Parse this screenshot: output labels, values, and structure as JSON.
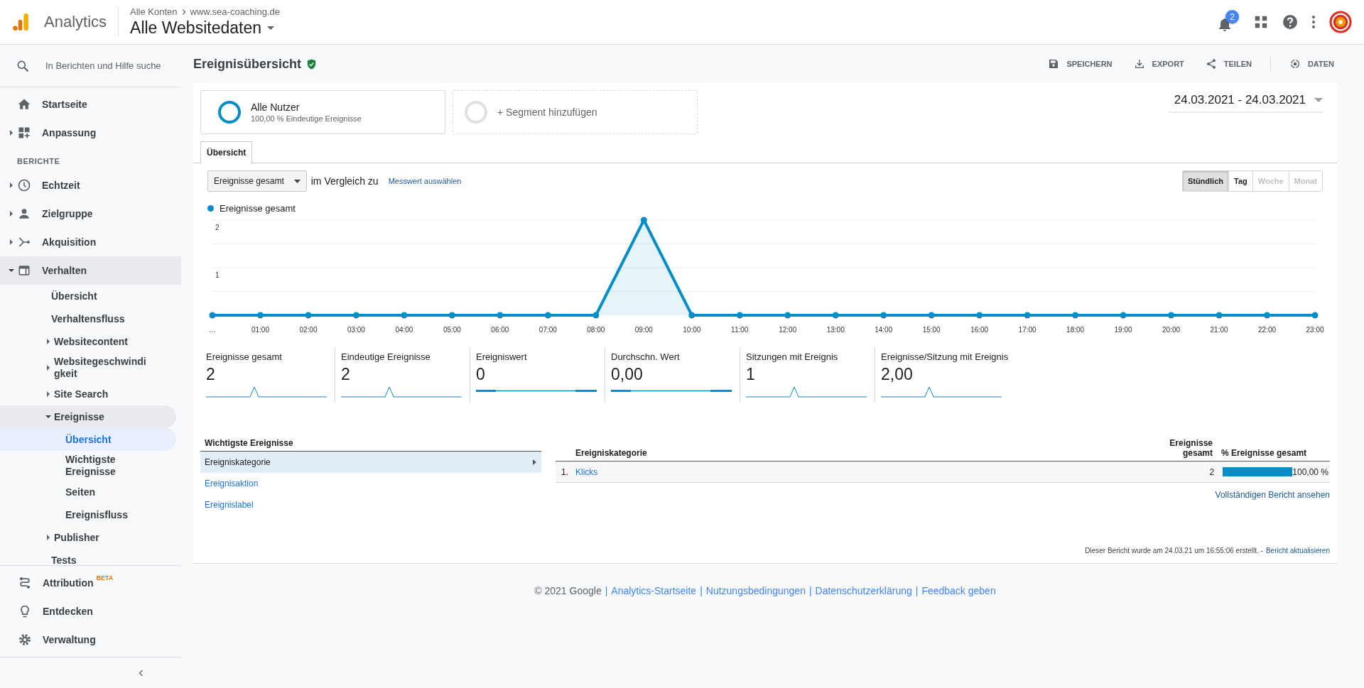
{
  "header": {
    "product": "Analytics",
    "breadcrumb": [
      "Alle Konten",
      "www.sea-coaching.de"
    ],
    "view": "Alle Websitedaten",
    "notification_count": "2"
  },
  "sidebar": {
    "search_placeholder": "In Berichten und Hilfe suche",
    "items": [
      {
        "kind": "item",
        "label": "Startseite",
        "selected": false
      },
      {
        "kind": "item",
        "label": "Anpassung",
        "expanded": false,
        "selected": false
      },
      {
        "kind": "heading",
        "label": "BERICHTE"
      },
      {
        "kind": "item",
        "label": "Echtzeit",
        "expanded": false,
        "selected": false
      },
      {
        "kind": "item",
        "label": "Zielgruppe",
        "expanded": false,
        "selected": false
      },
      {
        "kind": "item",
        "label": "Akquisition",
        "expanded": false,
        "selected": false
      },
      {
        "kind": "item",
        "label": "Verhalten",
        "expanded": true,
        "selected": false,
        "children": [
          {
            "label": "Übersicht",
            "selected": false
          },
          {
            "label": "Verhaltensfluss",
            "selected": false
          },
          {
            "label": "Websitecontent",
            "expanded": false,
            "selected": false
          },
          {
            "label": "Websitegeschwindigkeit",
            "expanded": false,
            "selected": false
          },
          {
            "label": "Site Search",
            "expanded": false,
            "selected": false
          },
          {
            "label": "Ereignisse",
            "expanded": true,
            "selected": false,
            "children": [
              {
                "label": "Übersicht",
                "selected": true
              },
              {
                "label": "Wichtigste Ereignisse",
                "selected": false
              },
              {
                "label": "Seiten",
                "selected": false
              },
              {
                "label": "Ereignisfluss",
                "selected": false
              }
            ]
          },
          {
            "label": "Publisher",
            "expanded": false,
            "selected": false
          },
          {
            "label": "Tests",
            "selected": false
          }
        ]
      }
    ],
    "bottom_items": [
      {
        "label": "Attribution",
        "badge": "BETA"
      },
      {
        "label": "Entdecken"
      },
      {
        "label": "Verwaltung"
      }
    ]
  },
  "page": {
    "title": "Ereignisübersicht",
    "actions": [
      "SPEICHERN",
      "EXPORT",
      "TEILEN",
      "DATEN"
    ],
    "segments": [
      {
        "kind": "active",
        "name": "Alle Nutzer",
        "detail": "100,00 % Eindeutige Ereignisse"
      },
      {
        "kind": "add",
        "name": "+ Segment hinzufügen"
      }
    ],
    "date_range": "24.03.2021 - 24.03.2021",
    "tabs": [
      {
        "label": "Übersicht",
        "selected": true
      }
    ],
    "metric_select": "Ereignisse gesamt",
    "compare_label": "im Vergleich zu",
    "compare_link": "Messwert auswählen",
    "granularity": [
      {
        "label": "Stündlich",
        "selected": true,
        "disabled": false
      },
      {
        "label": "Tag",
        "selected": false,
        "disabled": false
      },
      {
        "label": "Woche",
        "selected": false,
        "disabled": true
      },
      {
        "label": "Monat",
        "selected": false,
        "disabled": true
      }
    ],
    "chart_data": {
      "type": "area",
      "categories": [
        "…",
        "01:00",
        "02:00",
        "03:00",
        "04:00",
        "05:00",
        "06:00",
        "07:00",
        "08:00",
        "09:00",
        "10:00",
        "11:00",
        "12:00",
        "13:00",
        "14:00",
        "15:00",
        "16:00",
        "17:00",
        "18:00",
        "19:00",
        "20:00",
        "21:00",
        "22:00",
        "23:00"
      ],
      "series": [
        {
          "name": "Ereignisse gesamt",
          "color": "#058dc7",
          "values": [
            0,
            0,
            0,
            0,
            0,
            0,
            0,
            0,
            0,
            2,
            0,
            0,
            0,
            0,
            0,
            0,
            0,
            0,
            0,
            0,
            0,
            0,
            0,
            0
          ]
        }
      ],
      "ylim": [
        0,
        2
      ],
      "yticks": [
        1,
        2
      ]
    },
    "scorecards": [
      {
        "label": "Ereignisse gesamt",
        "value": "2",
        "kind": "spike"
      },
      {
        "label": "Eindeutige Ereignisse",
        "value": "2",
        "kind": "spike"
      },
      {
        "label": "Ereigniswert",
        "value": "0",
        "kind": "flat"
      },
      {
        "label": "Durchschn. Wert",
        "value": "0,00",
        "kind": "flat"
      },
      {
        "label": "Sitzungen mit Ereignis",
        "value": "1",
        "kind": "spike"
      },
      {
        "label": "Ereignisse/Sitzung mit Ereignis",
        "value": "2,00",
        "kind": "spike"
      }
    ],
    "top_events": {
      "title": "Wichtigste Ereignisse",
      "items": [
        {
          "label": "Ereigniskategorie",
          "selected": true
        },
        {
          "label": "Ereignisaktion",
          "selected": false
        },
        {
          "label": "Ereignislabel",
          "selected": false
        }
      ]
    },
    "table": {
      "columns": [
        "Ereigniskategorie",
        "Ereignisse gesamt",
        "% Ereignisse gesamt"
      ],
      "rows": [
        {
          "rank": "1.",
          "name": "Klicks",
          "value": "2",
          "level": 1.0,
          "percent": "100,00 %"
        }
      ],
      "full_report_link": "Vollständigen Bericht ansehen"
    },
    "report_note": "Dieser Bericht wurde am 24.03.21 um 16:55:06 erstellt. -",
    "report_refresh": "Bericht aktualisieren"
  },
  "footer": [
    {
      "kind": "text",
      "text": "© 2021 Google"
    },
    {
      "kind": "sep",
      "text": "|"
    },
    {
      "kind": "link",
      "text": "Analytics-Startseite"
    },
    {
      "kind": "sep",
      "text": "|"
    },
    {
      "kind": "link",
      "text": "Nutzungsbedingungen"
    },
    {
      "kind": "sep",
      "text": "|"
    },
    {
      "kind": "link",
      "text": "Datenschutzerklärung"
    },
    {
      "kind": "sep",
      "text": "|"
    },
    {
      "kind": "link",
      "text": "Feedback geben"
    }
  ]
}
